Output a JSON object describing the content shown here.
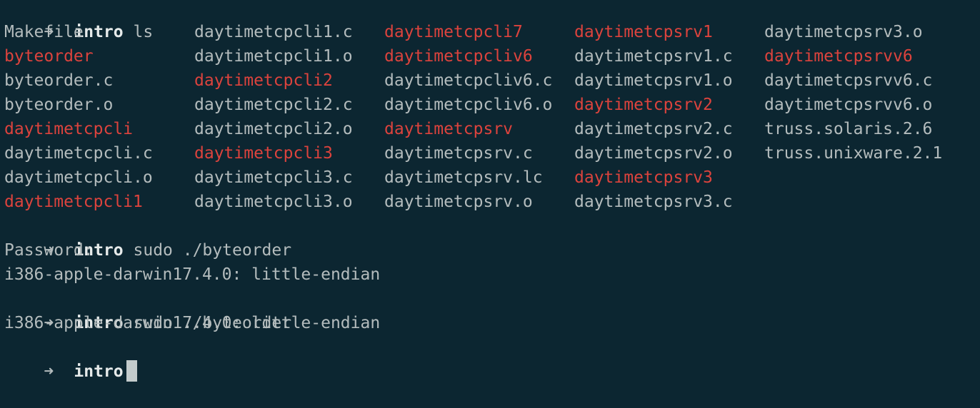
{
  "colors": {
    "background": "#0c2631",
    "text": "#b4bcbd",
    "executable": "#dc433d",
    "directory": "#e6eaea",
    "cursor": "#c3cbcc"
  },
  "prompt": {
    "arrow": "➜",
    "dir": "intro"
  },
  "commands": {
    "ls": "ls",
    "run1": "sudo ./byteorder",
    "run2": "sudo ./byteorder"
  },
  "ls_rows": [
    [
      {
        "name": "Makefile",
        "exec": false
      },
      {
        "name": "daytimetcpcli1.c",
        "exec": false
      },
      {
        "name": "daytimetcpcli7",
        "exec": true
      },
      {
        "name": "daytimetcpsrv1",
        "exec": true
      },
      {
        "name": "daytimetcpsrv3.o",
        "exec": false
      }
    ],
    [
      {
        "name": "byteorder",
        "exec": true
      },
      {
        "name": "daytimetcpcli1.o",
        "exec": false
      },
      {
        "name": "daytimetcpcliv6",
        "exec": true
      },
      {
        "name": "daytimetcpsrv1.c",
        "exec": false
      },
      {
        "name": "daytimetcpsrvv6",
        "exec": true
      }
    ],
    [
      {
        "name": "byteorder.c",
        "exec": false
      },
      {
        "name": "daytimetcpcli2",
        "exec": true
      },
      {
        "name": "daytimetcpcliv6.c",
        "exec": false
      },
      {
        "name": "daytimetcpsrv1.o",
        "exec": false
      },
      {
        "name": "daytimetcpsrvv6.c",
        "exec": false
      }
    ],
    [
      {
        "name": "byteorder.o",
        "exec": false
      },
      {
        "name": "daytimetcpcli2.c",
        "exec": false
      },
      {
        "name": "daytimetcpcliv6.o",
        "exec": false
      },
      {
        "name": "daytimetcpsrv2",
        "exec": true
      },
      {
        "name": "daytimetcpsrvv6.o",
        "exec": false
      }
    ],
    [
      {
        "name": "daytimetcpcli",
        "exec": true
      },
      {
        "name": "daytimetcpcli2.o",
        "exec": false
      },
      {
        "name": "daytimetcpsrv",
        "exec": true
      },
      {
        "name": "daytimetcpsrv2.c",
        "exec": false
      },
      {
        "name": "truss.solaris.2.6",
        "exec": false
      }
    ],
    [
      {
        "name": "daytimetcpcli.c",
        "exec": false
      },
      {
        "name": "daytimetcpcli3",
        "exec": true
      },
      {
        "name": "daytimetcpsrv.c",
        "exec": false
      },
      {
        "name": "daytimetcpsrv2.o",
        "exec": false
      },
      {
        "name": "truss.unixware.2.1",
        "exec": false
      }
    ],
    [
      {
        "name": "daytimetcpcli.o",
        "exec": false
      },
      {
        "name": "daytimetcpcli3.c",
        "exec": false
      },
      {
        "name": "daytimetcpsrv.lc",
        "exec": false
      },
      {
        "name": "daytimetcpsrv3",
        "exec": true
      }
    ],
    [
      {
        "name": "daytimetcpcli1",
        "exec": true
      },
      {
        "name": "daytimetcpcli3.o",
        "exec": false
      },
      {
        "name": "daytimetcpsrv.o",
        "exec": false
      },
      {
        "name": "daytimetcpsrv3.c",
        "exec": false
      }
    ]
  ],
  "output": {
    "password_prompt": "Password:",
    "result1": "i386-apple-darwin17.4.0: little-endian",
    "result2": "i386-apple-darwin17.4.0: little-endian"
  }
}
